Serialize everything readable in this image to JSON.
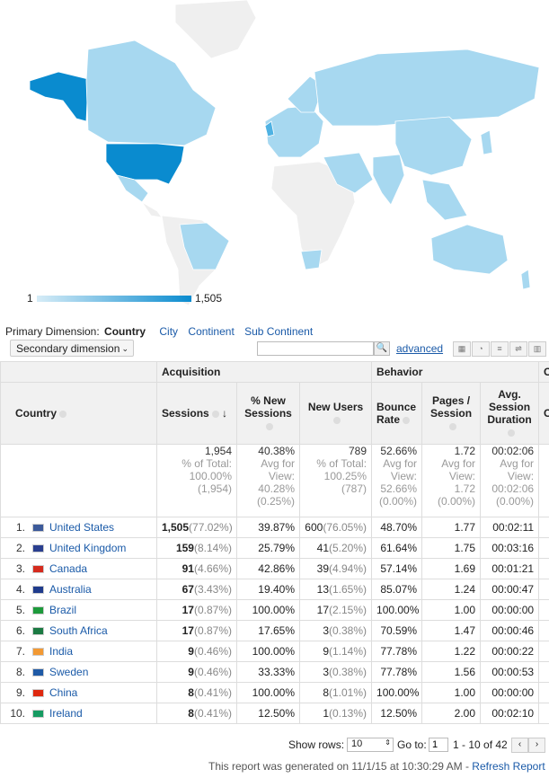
{
  "map": {
    "legend_min": "1",
    "legend_max": "1,505",
    "colors": {
      "low": "#d6ecf7",
      "mid": "#a7d8f0",
      "high": "#0a8bcf",
      "none": "#efefef"
    }
  },
  "primary_dimension": {
    "label": "Primary Dimension:",
    "selected": "Country",
    "options": [
      "City",
      "Continent",
      "Sub Continent"
    ]
  },
  "toolbar": {
    "secondary_dimension": "Secondary dimension",
    "search_placeholder": "",
    "advanced": "advanced"
  },
  "table": {
    "group_acquisition": "Acquisition",
    "group_behavior": "Behavior",
    "group_conversions": "C",
    "headers": {
      "country": "Country",
      "sessions": "Sessions",
      "new_sessions": "% New Sessions",
      "new_users": "New Users",
      "bounce": "Bounce Rate",
      "pages": "Pages / Session",
      "duration": "Avg. Session Duration",
      "extra": "C"
    },
    "totals": {
      "sessions": "1,954",
      "sessions_sub": "% of Total: 100.00% (1,954)",
      "new_sessions": "40.38%",
      "new_sessions_sub": "Avg for View: 40.28% (0.25%)",
      "new_users": "789",
      "new_users_sub": "% of Total: 100.25% (787)",
      "bounce": "52.66%",
      "bounce_sub": "Avg for View: 52.66% (0.00%)",
      "pages": "1.72",
      "pages_sub": "Avg for View: 1.72 (0.00%)",
      "duration": "00:02:06",
      "duration_sub": "Avg for View: 00:02:06 (0.00%)"
    },
    "rows": [
      {
        "n": "1.",
        "country": "United States",
        "sessions": "1,505",
        "sessions_pct": "(77.02%)",
        "new_sessions": "39.87%",
        "new_users": "600",
        "new_users_pct": "(76.05%)",
        "bounce": "48.70%",
        "pages": "1.77",
        "duration": "00:02:11"
      },
      {
        "n": "2.",
        "country": "United Kingdom",
        "sessions": "159",
        "sessions_pct": "(8.14%)",
        "new_sessions": "25.79%",
        "new_users": "41",
        "new_users_pct": "(5.20%)",
        "bounce": "61.64%",
        "pages": "1.75",
        "duration": "00:03:16"
      },
      {
        "n": "3.",
        "country": "Canada",
        "sessions": "91",
        "sessions_pct": "(4.66%)",
        "new_sessions": "42.86%",
        "new_users": "39",
        "new_users_pct": "(4.94%)",
        "bounce": "57.14%",
        "pages": "1.69",
        "duration": "00:01:21"
      },
      {
        "n": "4.",
        "country": "Australia",
        "sessions": "67",
        "sessions_pct": "(3.43%)",
        "new_sessions": "19.40%",
        "new_users": "13",
        "new_users_pct": "(1.65%)",
        "bounce": "85.07%",
        "pages": "1.24",
        "duration": "00:00:47"
      },
      {
        "n": "5.",
        "country": "Brazil",
        "sessions": "17",
        "sessions_pct": "(0.87%)",
        "new_sessions": "100.00%",
        "new_users": "17",
        "new_users_pct": "(2.15%)",
        "bounce": "100.00%",
        "pages": "1.00",
        "duration": "00:00:00"
      },
      {
        "n": "6.",
        "country": "South Africa",
        "sessions": "17",
        "sessions_pct": "(0.87%)",
        "new_sessions": "17.65%",
        "new_users": "3",
        "new_users_pct": "(0.38%)",
        "bounce": "70.59%",
        "pages": "1.47",
        "duration": "00:00:46"
      },
      {
        "n": "7.",
        "country": "India",
        "sessions": "9",
        "sessions_pct": "(0.46%)",
        "new_sessions": "100.00%",
        "new_users": "9",
        "new_users_pct": "(1.14%)",
        "bounce": "77.78%",
        "pages": "1.22",
        "duration": "00:00:22"
      },
      {
        "n": "8.",
        "country": "Sweden",
        "sessions": "9",
        "sessions_pct": "(0.46%)",
        "new_sessions": "33.33%",
        "new_users": "3",
        "new_users_pct": "(0.38%)",
        "bounce": "77.78%",
        "pages": "1.56",
        "duration": "00:00:53"
      },
      {
        "n": "9.",
        "country": "China",
        "sessions": "8",
        "sessions_pct": "(0.41%)",
        "new_sessions": "100.00%",
        "new_users": "8",
        "new_users_pct": "(1.01%)",
        "bounce": "100.00%",
        "pages": "1.00",
        "duration": "00:00:00"
      },
      {
        "n": "10.",
        "country": "Ireland",
        "sessions": "8",
        "sessions_pct": "(0.41%)",
        "new_sessions": "12.50%",
        "new_users": "1",
        "new_users_pct": "(0.13%)",
        "bounce": "12.50%",
        "pages": "2.00",
        "duration": "00:02:10"
      }
    ],
    "flags": [
      "#3c5a9a",
      "#2a3f8f",
      "#d52b1e",
      "#1f3b8c",
      "#1d9a3b",
      "#1c7a43",
      "#f29933",
      "#1f5aa6",
      "#de2910",
      "#169b62"
    ]
  },
  "pager": {
    "show_rows_label": "Show rows:",
    "rows_value": "10",
    "goto_label": "Go to:",
    "page_value": "1",
    "range": "1 - 10 of 42"
  },
  "footer": {
    "text": "This report was generated on 11/1/15 at 10:30:29 AM - ",
    "refresh": "Refresh Report"
  }
}
